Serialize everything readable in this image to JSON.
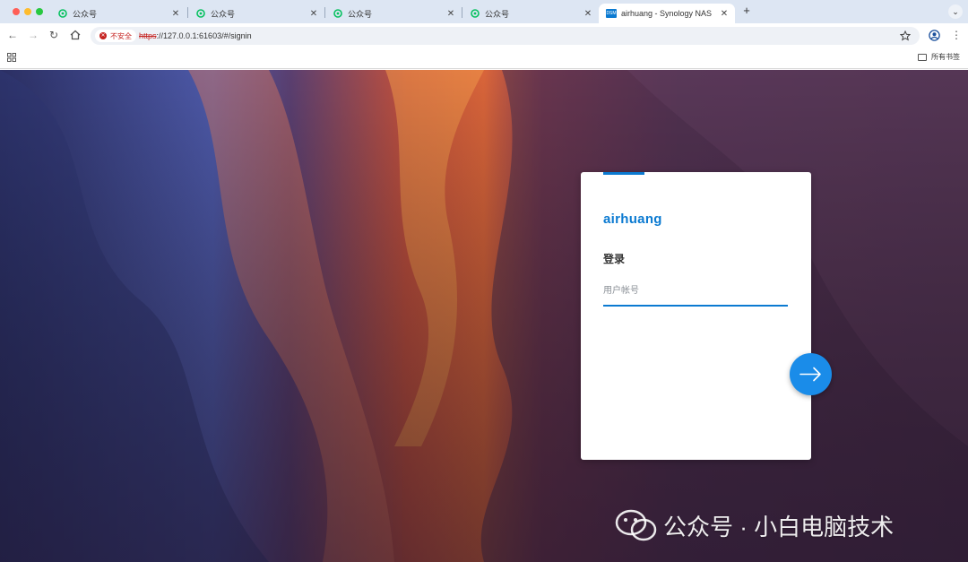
{
  "browser": {
    "tabs": [
      {
        "label": "公众号",
        "active": false
      },
      {
        "label": "公众号",
        "active": false
      },
      {
        "label": "公众号",
        "active": false
      },
      {
        "label": "公众号",
        "active": false
      },
      {
        "label": "airhuang - Synology NAS",
        "active": true
      }
    ],
    "active_tab_icon_text": "DSM",
    "security_chip": "不安全",
    "url_scheme": "https",
    "url_rest": "://127.0.0.1:61603/#/signin",
    "all_bookmarks": "所有书签"
  },
  "login": {
    "hostname": "airhuang",
    "heading": "登录",
    "username_placeholder": "用户帐号",
    "username_value": ""
  },
  "watermark": {
    "text": "公众号 · 小白电脑技术"
  },
  "colors": {
    "accent": "#0b7ad1",
    "next_button": "#1a8ce9",
    "tabbar": "#dde6f3",
    "insecure": "#c5221f"
  }
}
